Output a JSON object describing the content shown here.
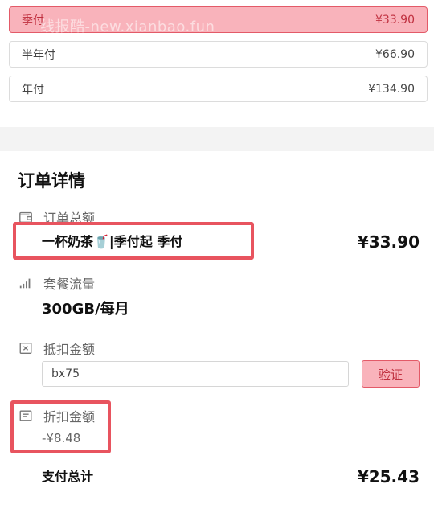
{
  "plans": [
    {
      "label": "季付",
      "price": "¥33.90",
      "selected": true
    },
    {
      "label": "半年付",
      "price": "¥66.90",
      "selected": false
    },
    {
      "label": "年付",
      "price": "¥134.90",
      "selected": false
    }
  ],
  "watermark": "线报酷-new.xianbao.fun",
  "order": {
    "title": "订单详情",
    "total_label": "订单总额",
    "product_name": "一杯奶茶🥤|季付起 季付",
    "total_price": "¥33.90",
    "traffic_label": "套餐流量",
    "traffic_value": "300GB/每月",
    "coupon_label": "抵扣金额",
    "coupon_value": "bx75",
    "verify_label": "验证",
    "discount_label": "折扣金额",
    "discount_value": "-¥8.48",
    "pay_total_label": "支付总计",
    "pay_total_value": "¥25.43"
  },
  "colors": {
    "accent": "#e35a68",
    "accent_bg": "#f9b3bb",
    "highlight": "#e8545f"
  },
  "icons": {
    "total": "wallet-icon",
    "traffic": "signal-bars-icon",
    "coupon": "coupon-x-icon",
    "discount": "receipt-icon"
  }
}
